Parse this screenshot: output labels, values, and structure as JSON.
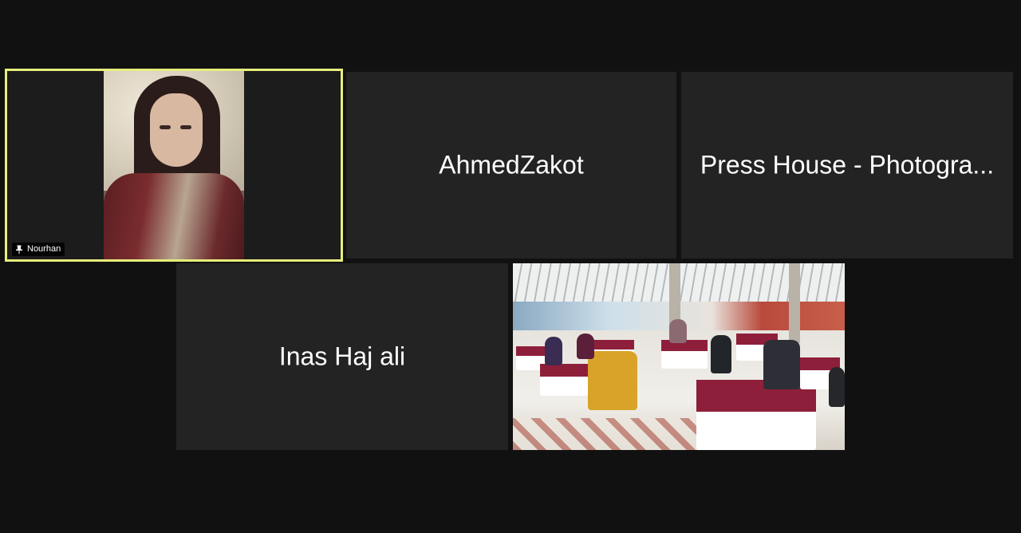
{
  "participants": [
    {
      "name": "Nourhan",
      "video": true,
      "pinned": true,
      "active_speaker": true
    },
    {
      "name": "AhmedZakot",
      "video": false
    },
    {
      "name": "Press House - Photogra...",
      "video": false
    },
    {
      "name": "Inas Haj ali",
      "video": false
    },
    {
      "name": "",
      "video": true
    }
  ],
  "icons": {
    "pin": "pin-icon"
  },
  "colors": {
    "background": "#111111",
    "tile_background": "#232323",
    "active_speaker_border": "#e6ee7a",
    "name_text": "#ffffff"
  }
}
